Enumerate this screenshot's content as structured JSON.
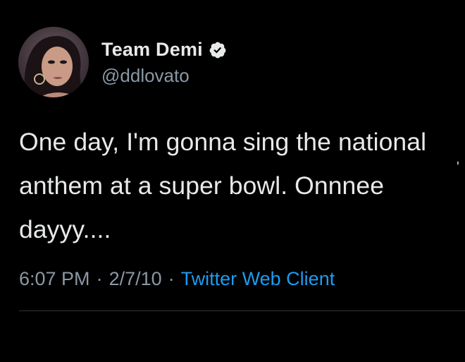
{
  "tweet": {
    "author": {
      "display_name": "Team Demi",
      "handle": "@ddlovato",
      "verified": true
    },
    "text": "One day, I'm gonna sing the national\nanthem at a super bowl. Onnnee\ndayyy....",
    "meta": {
      "time": "6:07 PM",
      "separator": "·",
      "date": "2/7/10",
      "client": "Twitter Web Client"
    }
  },
  "icons": {
    "verified": "verified-badge-icon",
    "avatar": "profile-photo"
  },
  "colors": {
    "background": "#000000",
    "primary_text": "#e7e9ea",
    "secondary_text": "#8b98a5",
    "link": "#1d9bf0",
    "divider": "#2f3336"
  }
}
